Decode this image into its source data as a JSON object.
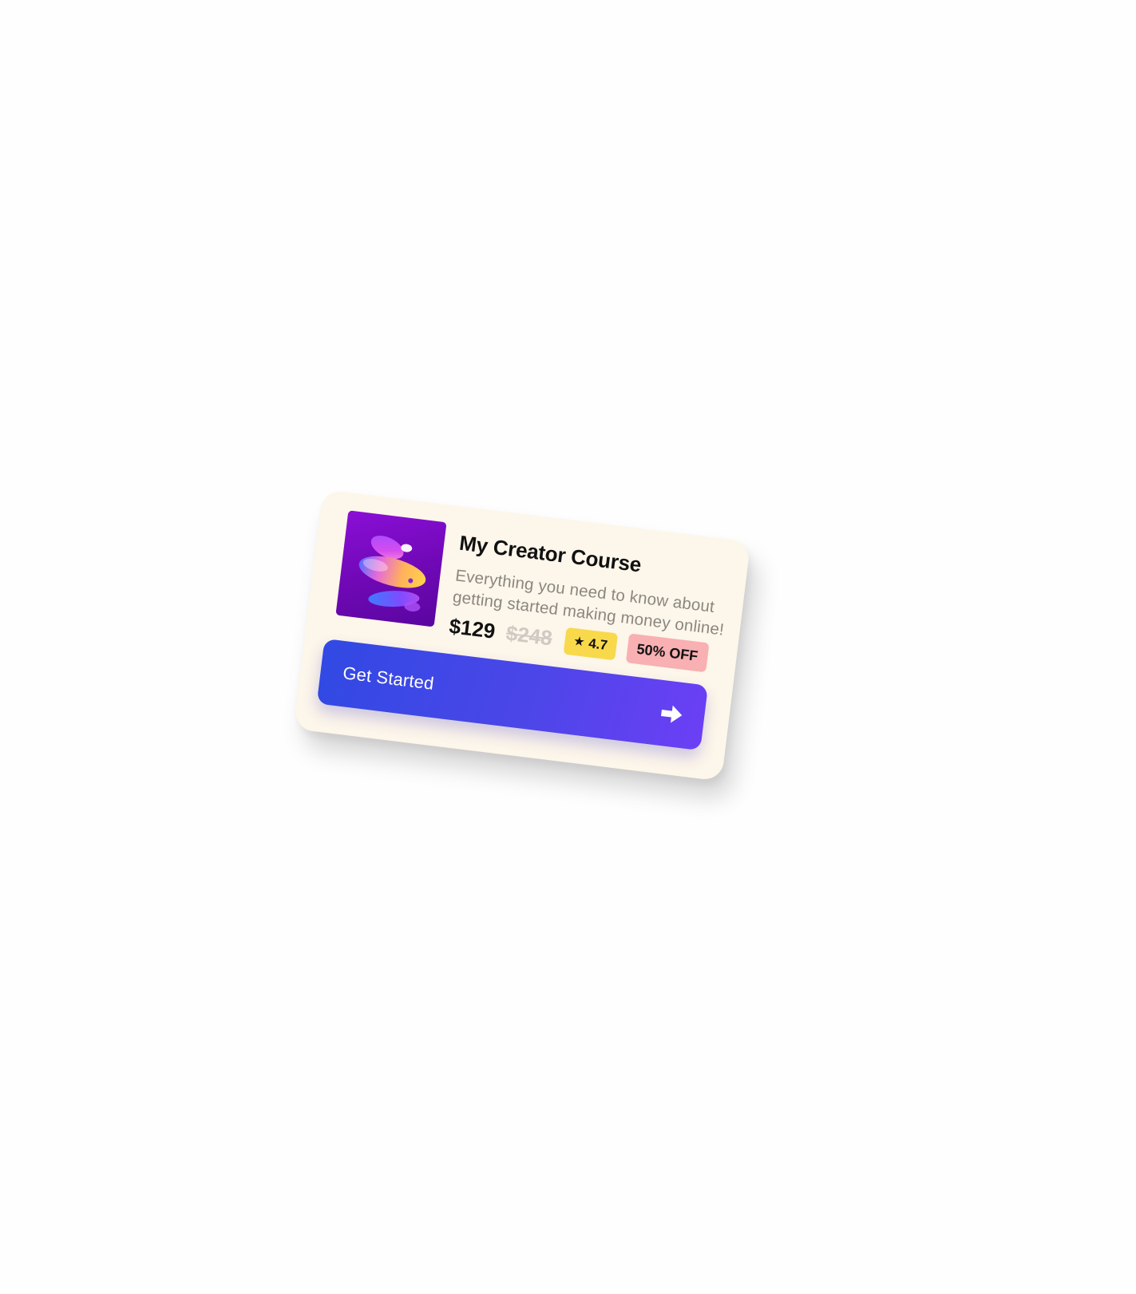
{
  "course_card": {
    "title": "My Creator Course",
    "description": "Everything you need to know about getting started making money online!",
    "price": "$129",
    "original_price": "$248",
    "rating": "4.7",
    "discount_badge": "50% OFF",
    "cta_label": "Get Started",
    "icons": {
      "rating": "star-icon",
      "cta": "arrow-right-icon",
      "thumbnail": "abstract-3d-shapes-image"
    }
  },
  "colors": {
    "page_background": "#fefefe",
    "card_background": "#fdf6ea",
    "thumbnail_background": "#7a0bc4",
    "rating_badge": "#f9d94c",
    "discount_badge": "#f8b0b3",
    "cta_gradient_start": "#3149e3",
    "cta_gradient_end": "#6c3ff5"
  }
}
